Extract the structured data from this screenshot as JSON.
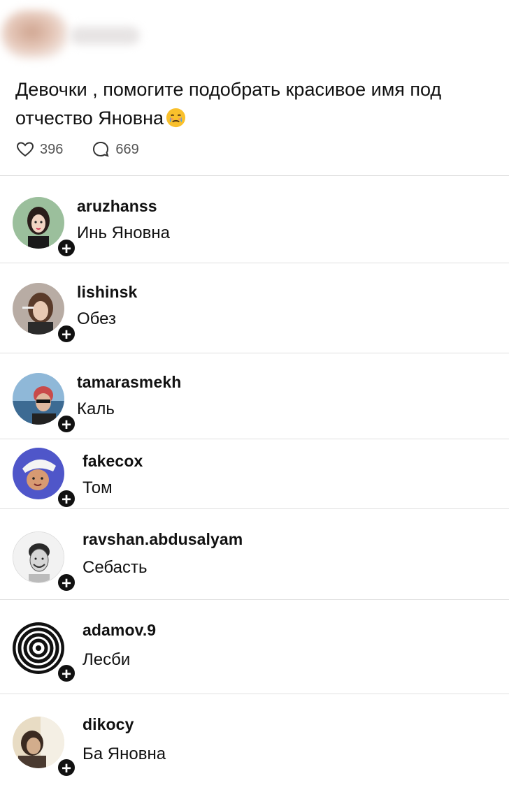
{
  "post": {
    "text": "Девочки , помогите подобрать красивое имя под отчество Яновна",
    "likes": "396",
    "comments": "669"
  },
  "replies": [
    {
      "username": "aruzhanss",
      "text": "Инь Яновна"
    },
    {
      "username": "lishinsk",
      "text": "Обез"
    },
    {
      "username": "tamarasmekh",
      "text": "Каль"
    },
    {
      "username": "fakecox",
      "text": "Том"
    },
    {
      "username": "ravshan.abdusalyam",
      "text": "Себасть"
    },
    {
      "username": "adamov.9",
      "text": "Лесби"
    },
    {
      "username": "dikocy",
      "text": "Ба Яновна"
    }
  ],
  "icons": {
    "like": "heart-icon",
    "comment": "speech-bubble-icon",
    "follow": "plus-icon",
    "emoji": "face-holding-back-tears-emoji"
  }
}
